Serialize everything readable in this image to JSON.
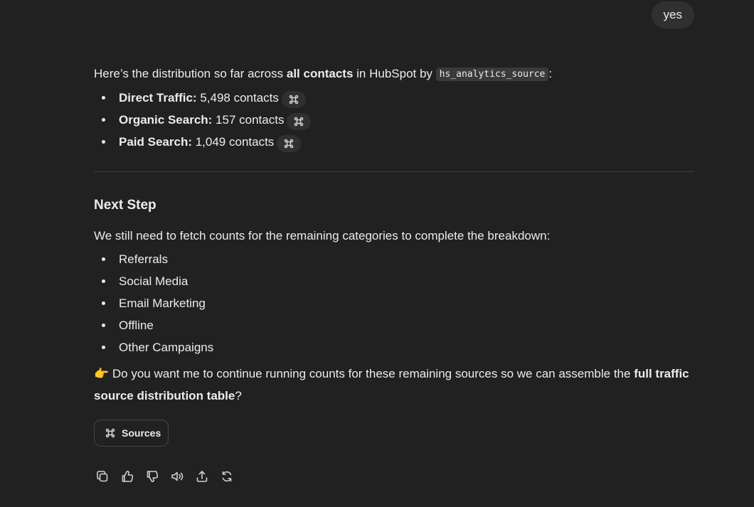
{
  "user_message": "yes",
  "answer": {
    "intro_pre": "Here’s the distribution so far across ",
    "intro_bold": "all contacts",
    "intro_mid": " in HubSpot by ",
    "intro_code": "hs_analytics_source",
    "intro_post": ":",
    "distribution": [
      {
        "label": "Direct Traffic:",
        "value": " 5,498 contacts"
      },
      {
        "label": "Organic Search:",
        "value": " 157 contacts"
      },
      {
        "label": "Paid Search:",
        "value": " 1,049 contacts"
      }
    ],
    "next_heading": "Next Step",
    "next_text": "We still need to fetch counts for the remaining categories to complete the breakdown:",
    "remaining": [
      "Referrals",
      "Social Media",
      "Email Marketing",
      "Offline",
      "Other Campaigns"
    ],
    "ask_emoji": "👉",
    "ask_pre": " Do you want me to continue running counts for these remaining sources so we can assemble the ",
    "ask_bold": "full traffic source distribution table",
    "ask_post": "?",
    "sources_label": "Sources"
  },
  "icons": {
    "cite": "link-command-icon",
    "copy": "copy-icon",
    "like": "thumbs-up-icon",
    "dislike": "thumbs-down-icon",
    "read_aloud": "speaker-icon",
    "share": "share-icon",
    "regenerate": "regenerate-icon"
  },
  "colors": {
    "background": "#212121",
    "text": "#ececec",
    "bubble": "#303030"
  }
}
